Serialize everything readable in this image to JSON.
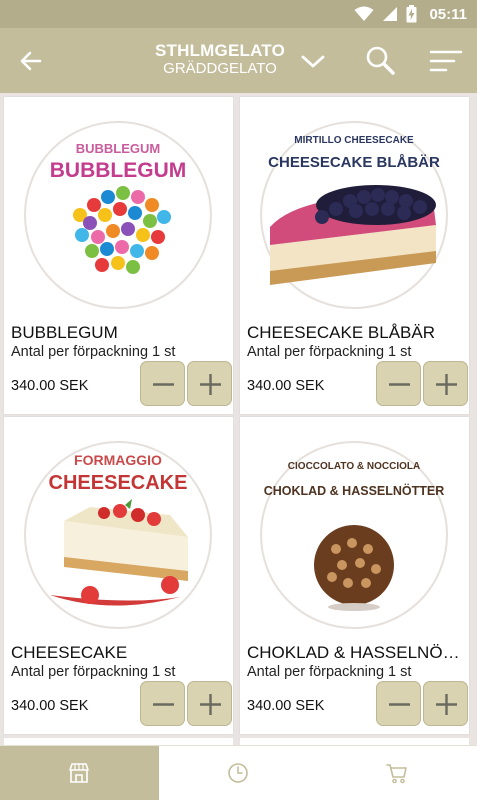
{
  "status_bar": {
    "time": "05:11",
    "icons": [
      "wifi-icon",
      "signal-icon",
      "battery-charging-icon"
    ]
  },
  "app_bar": {
    "title": "STHLMGELATO",
    "subtitle": "GRÄDDGELATO",
    "icons": [
      "back-arrow-icon",
      "chevron-down-icon",
      "search-icon",
      "sort-menu-icon"
    ]
  },
  "products": [
    {
      "name": "BUBBLEGUM",
      "package_text": "Antal per förpackning 1 st",
      "price": "340.00 SEK",
      "image_text_top": "BUBBLEGUM",
      "image_text_main": "BUBBLEGUM"
    },
    {
      "name": "CHEESECAKE BLÅBÄR",
      "package_text": "Antal per förpackning 1 st",
      "price": "340.00 SEK",
      "image_text_top": "MIRTILLO CHEESECAKE",
      "image_text_main": "CHEESECAKE BLÅBÄR"
    },
    {
      "name": "CHEESECAKE",
      "package_text": "Antal per förpackning 1 st",
      "price": "340.00 SEK",
      "image_text_top": "FORMAGGIO",
      "image_text_main": "CHEESECAKE"
    },
    {
      "name": "CHOKLAD & HASSELNÖTTER",
      "package_text": "Antal per förpackning 1 st",
      "price": "340.00 SEK",
      "image_text_top": "CIOCCOLATO & NOCCIOLA",
      "image_text_main": "CHOKLAD & HASSELNÖTTER"
    }
  ],
  "bottom_nav": [
    {
      "icon": "store-icon",
      "active": true
    },
    {
      "icon": "clock-icon",
      "active": false
    },
    {
      "icon": "cart-icon",
      "active": false
    }
  ],
  "colors": {
    "accent": "#c3bd9c",
    "status_bar": "#b3ad8c",
    "button": "#d9d3b1"
  }
}
